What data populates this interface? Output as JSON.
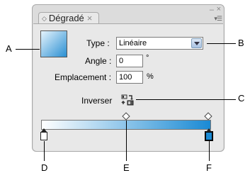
{
  "panel": {
    "tab_title": "Dégradé",
    "tab_close": "×",
    "window_minimize": "–",
    "window_close": "×",
    "menu_icon": "▾☰"
  },
  "fields": {
    "type_label": "Type :",
    "type_value": "Linéaire",
    "angle_label": "Angle :",
    "angle_value": "0",
    "angle_unit": "°",
    "location_label": "Emplacement :",
    "location_value": "100",
    "location_unit": "%",
    "reverse_label": "Inverser"
  },
  "gradient": {
    "start_color": "#ffffff",
    "end_color": "#1a8ad4"
  },
  "callouts": {
    "A": "A",
    "B": "B",
    "C": "C",
    "D": "D",
    "E": "E",
    "F": "F"
  }
}
